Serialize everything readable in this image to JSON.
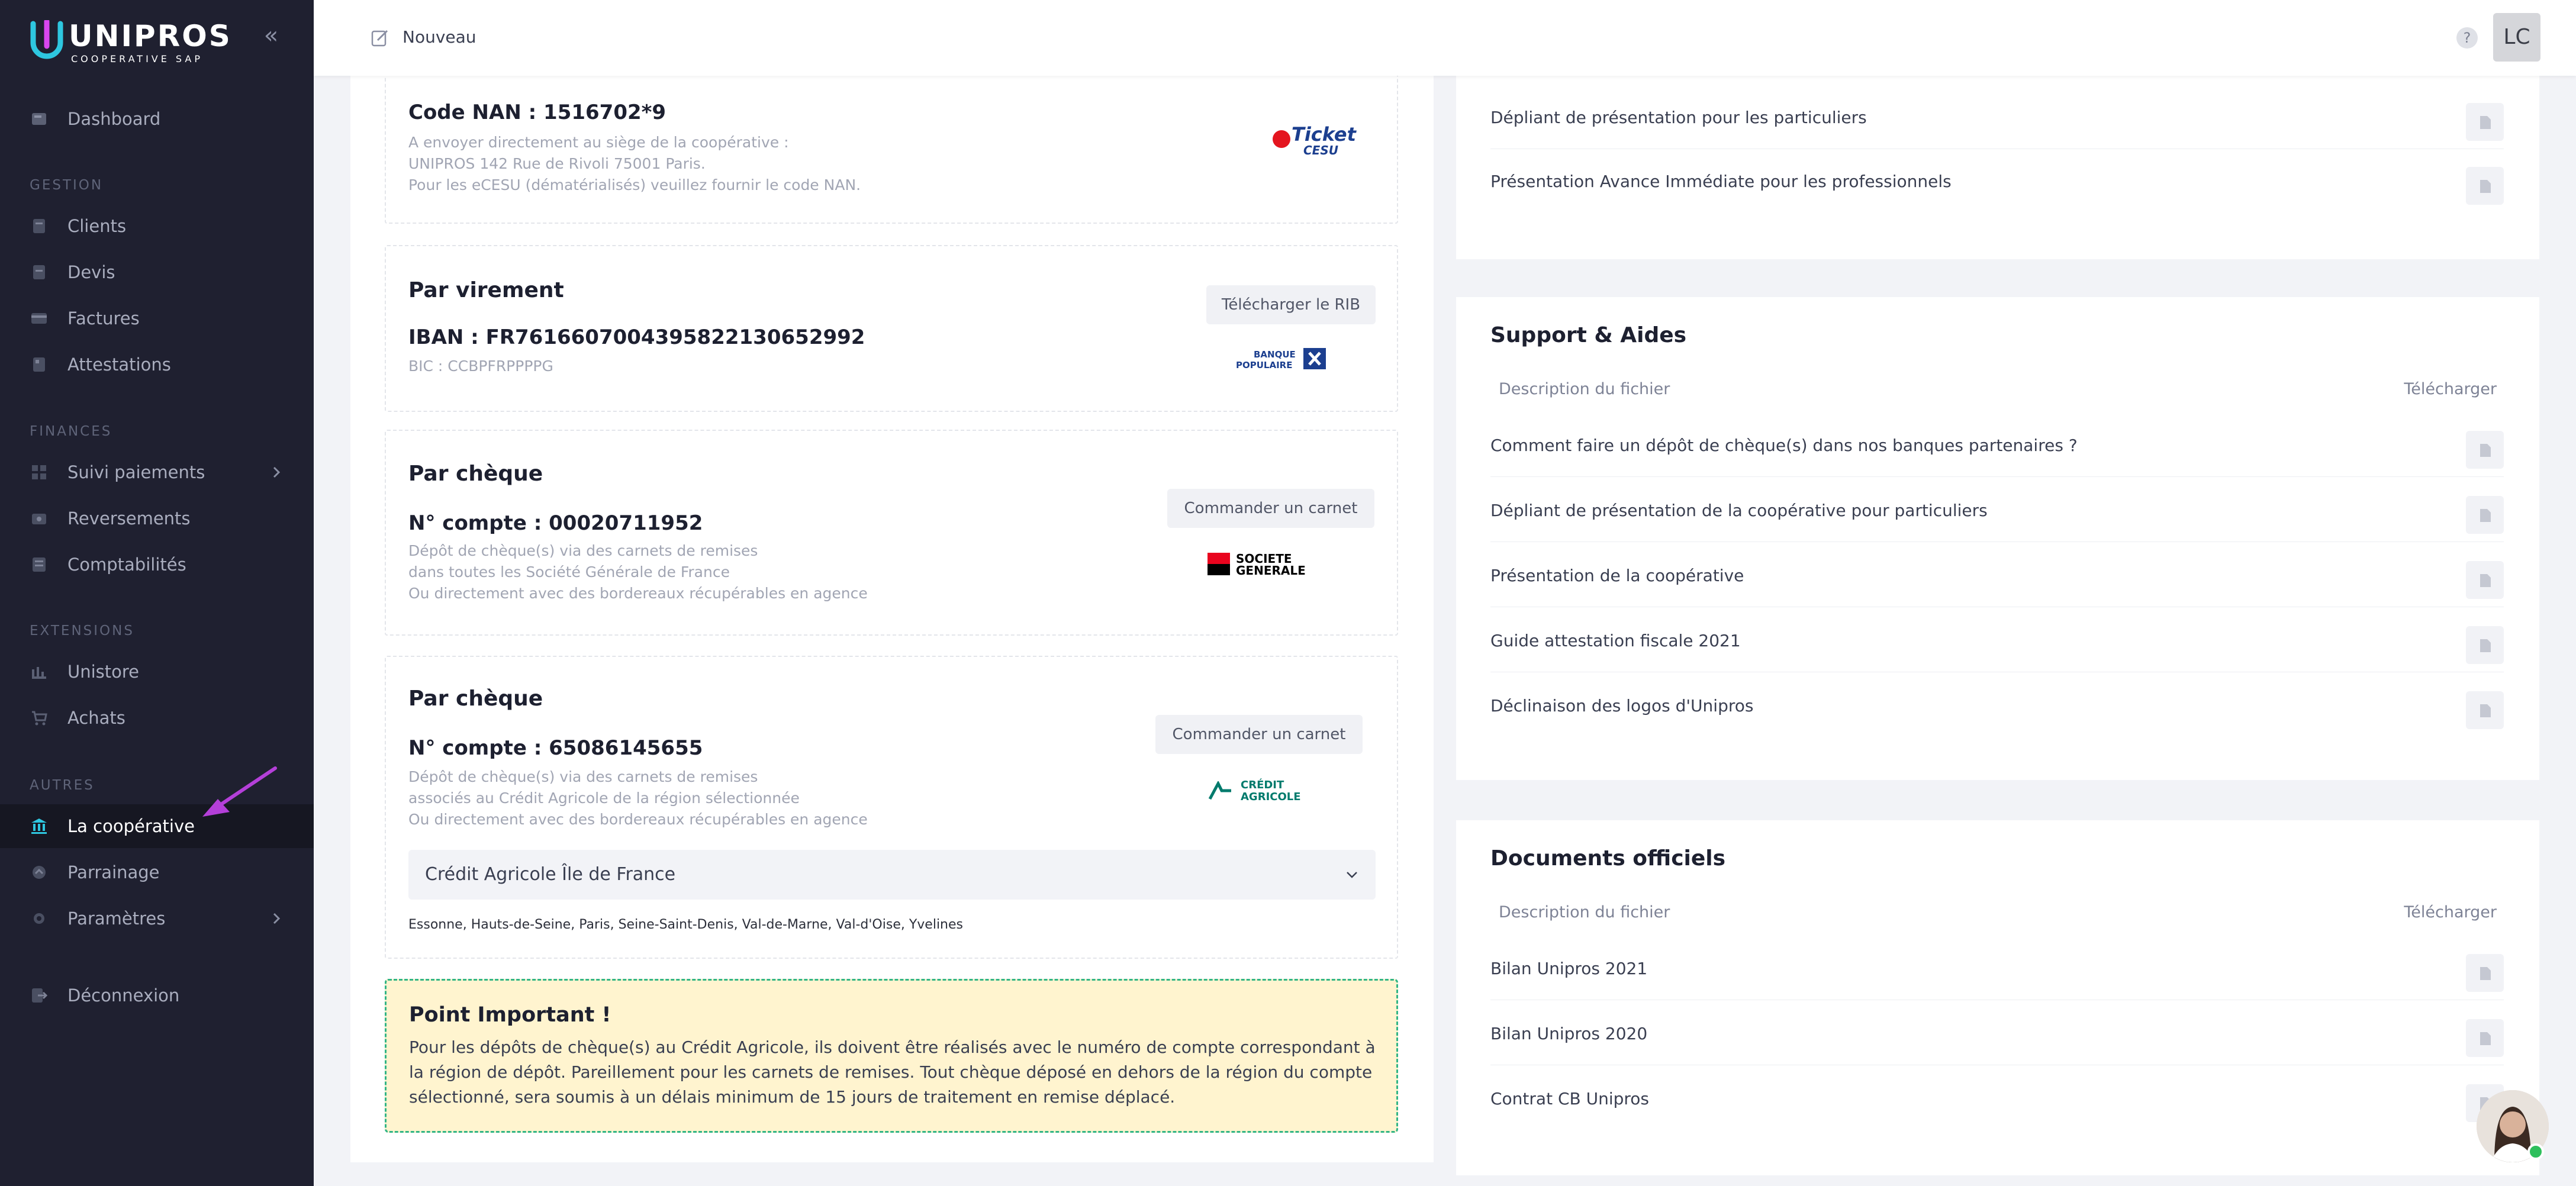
{
  "app": {
    "logo_text": "UNIPROS",
    "logo_subtitle": "COOPERATIVE SAP"
  },
  "sidebar": {
    "dashboard": "Dashboard",
    "sections": {
      "gestion": "GESTION",
      "finances": "FINANCES",
      "extensions": "EXTENSIONS",
      "autres": "AUTRES"
    },
    "items": {
      "clients": "Clients",
      "devis": "Devis",
      "factures": "Factures",
      "attestations": "Attestations",
      "suivi": "Suivi paiements",
      "reversements": "Reversements",
      "comptabilites": "Comptabilités",
      "unistore": "Unistore",
      "achats": "Achats",
      "cooperative": "La coopérative",
      "parrainage": "Parrainage",
      "parametres": "Paramètres",
      "deconnexion": "Déconnexion"
    },
    "active": "cooperative"
  },
  "topbar": {
    "new_label": "Nouveau",
    "help": "?",
    "user_initials": "LC"
  },
  "payments": {
    "cesu": {
      "title": "Code NAN : 1516702*9",
      "lines": [
        "A envoyer directement au siège de la coopérative :",
        "UNIPROS 142 Rue de Rivoli 75001 Paris.",
        "Pour les eCESU (dématérialisés) veuillez fournir le code NAN."
      ],
      "logo_main": "Ticket",
      "logo_sub": "CESU"
    },
    "virement": {
      "title": "Par virement",
      "button": "Télécharger le RIB",
      "iban": "IBAN : FR7616607004395822130652992",
      "bic": "BIC : CCBPFRPPPPG",
      "logo_line1": "BANQUE",
      "logo_line2": "POPULAIRE"
    },
    "cheque_sg": {
      "title": "Par chèque",
      "button": "Commander un carnet",
      "account": "N° compte : 00020711952",
      "lines": [
        "Dépôt de chèque(s) via des carnets de remises",
        "dans toutes les Société Générale de France",
        "Ou directement avec des bordereaux récupérables en agence"
      ],
      "logo_line1": "SOCIETE",
      "logo_line2": "GENERALE"
    },
    "cheque_ca": {
      "title": "Par chèque",
      "button": "Commander un carnet",
      "account": "N° compte : 65086145655",
      "lines": [
        "Dépôt de chèque(s) via des carnets de remises",
        "associés au Crédit Agricole de la région sélectionnée",
        "Ou directement avec des bordereaux récupérables en agence"
      ],
      "logo_line1": "CRÉDIT",
      "logo_line2": "AGRICOLE",
      "region_selected": "Crédit Agricole Île de France",
      "departments": "Essonne, Hauts-de-Seine, Paris, Seine-Saint-Denis, Val-de-Marne, Val-d'Oise, Yvelines"
    },
    "notice": {
      "title": "Point Important !",
      "text": "Pour les dépôts de chèque(s) au Crédit Agricole, ils doivent être réalisés avec le numéro de compte correspondant à la région de dépôt. Pareillement pour les carnets de remises. Tout chèque déposé en dehors de la région du compte sélectionné, sera soumis à un délais minimum de 15 jours de traitement en remise déplacé."
    }
  },
  "documents": {
    "top": [
      "Dépliant de présentation pour les particuliers",
      "Présentation Avance Immédiate pour les professionnels"
    ],
    "support": {
      "title": "Support & Aides",
      "col_desc": "Description du fichier",
      "col_dl": "Télécharger",
      "rows": [
        "Comment faire un dépôt de chèque(s) dans nos banques partenaires ?",
        "Dépliant de présentation de la coopérative pour particuliers",
        "Présentation de la coopérative",
        "Guide attestation fiscale 2021",
        "Déclinaison des logos d'Unipros"
      ]
    },
    "official": {
      "title": "Documents officiels",
      "col_desc": "Description du fichier",
      "col_dl": "Télécharger",
      "rows": [
        "Bilan Unipros 2021",
        "Bilan Unipros 2020",
        "Contrat CB Unipros"
      ]
    }
  },
  "colors": {
    "sidebar_bg": "#1f2030",
    "notice_bg": "#fff4cf",
    "notice_border": "#32b585",
    "accent_arrow": "#b43fd9",
    "cesu_red": "#e4151f",
    "bp_blue": "#1c3f8f",
    "sg_red": "#e9041e",
    "ca_green": "#007a6c"
  }
}
